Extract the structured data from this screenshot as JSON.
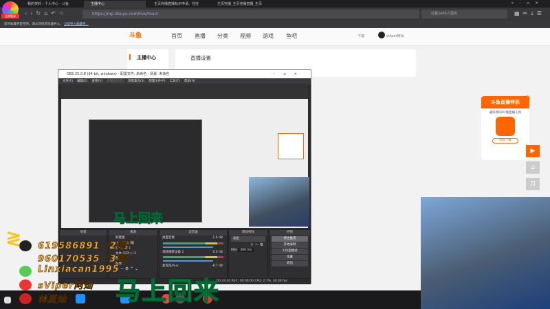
{
  "browser": {
    "badge": "立即登录",
    "tabs": [
      "我的资料 - 个人中心 - 斗鱼",
      "主播中心",
      "主页完播直播标示申请、往往",
      "主页完播_主页完播直播_主页"
    ],
    "url": "https://mp.douyu.com/live/main",
    "search_placeholder": "打赢2400人围攻",
    "notice": "您的收藏夹是空的，请从其他浏览器导入。",
    "notice_link": "立即导入收藏夹..."
  },
  "site": {
    "logo": "斗鱼",
    "nav": [
      "首页",
      "直播",
      "分类",
      "视频",
      "游戏",
      "鱼吧"
    ],
    "download": "下载",
    "user": "sViper阿灿",
    "sidebar_title": "主播中心",
    "content_title": "直播设置"
  },
  "obs": {
    "title": "OBS 25.0.8 (64-bit, windows) - 配置文件: 未命名 - 场景: 未命名",
    "menu": [
      "文件(F)",
      "编辑(E)",
      "查看(V)",
      "停靠窗口(D)",
      "场景集合(S)",
      "配置文件(P)",
      "工具(T)",
      "帮助(H)"
    ],
    "docks": {
      "scenes": "场景",
      "sources": "来源",
      "mixer": "混音器",
      "transitions": "转场特效",
      "controls": "控制"
    },
    "sources": [
      "如意图",
      "小窗网页加载",
      "画面采集 1",
      "文本 (GDI+) 2",
      "图",
      "图像"
    ],
    "mixer": [
      {
        "name": "桌面音频",
        "db": "-1.6 dB"
      },
      {
        "name": "视频捕获设备 2",
        "db": "0.0 dB"
      },
      {
        "name": "麦克风/Aux",
        "db": "-8.7 dB"
      }
    ],
    "transition": "淡出",
    "duration_label": "时长",
    "duration": "300 ms",
    "controls": [
      "停止推流",
      "开始录制",
      "工作室模式",
      "设置",
      "退出"
    ],
    "status": "00:33:20   REC: 00:00:00   CPU: 2.7%, 30.00 fps"
  },
  "ad": {
    "title": "斗鱼直播伴侣",
    "subtitle": "最好用的PC端直播工具",
    "button": "立即下载"
  },
  "overlay": {
    "lines": [
      "619586891（2群）",
      "960170535（3群）",
      "Linxiacan1995",
      "sViper阿灿",
      "林夏灿"
    ],
    "banner": "马上回来"
  }
}
